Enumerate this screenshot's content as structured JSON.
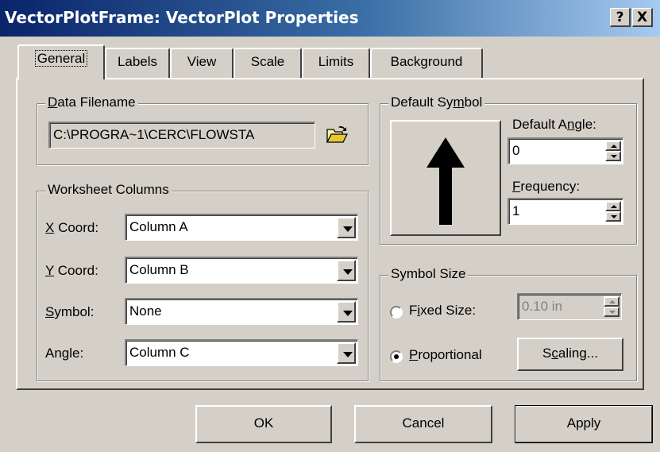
{
  "window": {
    "title": "VectorPlotFrame: VectorPlot Properties",
    "help_label": "?",
    "close_label": "X"
  },
  "tabs": [
    {
      "label": "General",
      "active": true
    },
    {
      "label": "Labels"
    },
    {
      "label": "View"
    },
    {
      "label": "Scale"
    },
    {
      "label": "Limits"
    },
    {
      "label": "Background"
    }
  ],
  "data_file": {
    "group_label_mnemonic": "D",
    "group_label_rest": "ata Filename",
    "value": "C:\\PROGRA~1\\CERC\\FLOWSTA",
    "browse_icon": "folder-open-icon"
  },
  "worksheet": {
    "group_label": "Worksheet Columns",
    "rows": [
      {
        "mnemonic": "X",
        "label_rest": " Coord:",
        "value": "Column A"
      },
      {
        "mnemonic": "Y",
        "label_rest": " Coord:",
        "value": "Column B"
      },
      {
        "mnemonic": "S",
        "label_rest": "ymbol:",
        "value": "None"
      },
      {
        "label_pre": "An",
        "mnemonic": "g",
        "label_rest": "le:",
        "value": "Column C"
      }
    ]
  },
  "default_symbol": {
    "group_label_pre": "Default Sy",
    "group_label_mnemonic": "m",
    "group_label_rest": "bol",
    "angle_label_pre": "Default A",
    "angle_label_mnemonic": "n",
    "angle_label_rest": "gle:",
    "angle_value": "0",
    "frequency_mnemonic": "F",
    "frequency_label_rest": "requency:",
    "frequency_value": "1",
    "preview_icon": "arrow-up-icon"
  },
  "symbol_size": {
    "group_label": "Symbol Size",
    "fixed_label_pre": "F",
    "fixed_mnemonic": "i",
    "fixed_label_rest": "xed Size:",
    "fixed_value": "0.10 in",
    "proportional_mnemonic": "P",
    "proportional_label_rest": "roportional",
    "scaling_pre": "S",
    "scaling_mnemonic": "c",
    "scaling_rest": "aling...",
    "selected": "proportional"
  },
  "footer": {
    "ok_label": "OK",
    "cancel_label": "Cancel",
    "apply_label": "Apply"
  }
}
